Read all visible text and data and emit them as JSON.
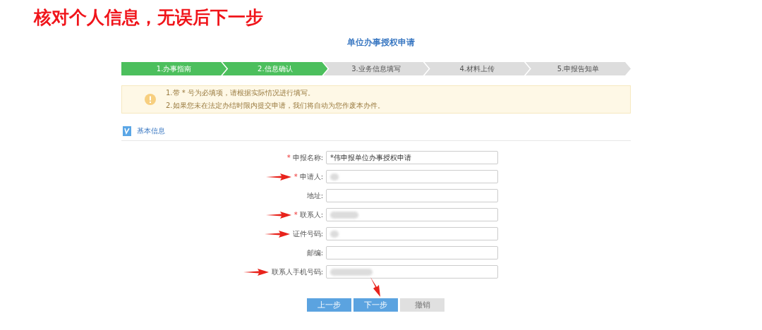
{
  "annotation": {
    "heading": "核对个人信息，无误后下一步"
  },
  "page_title": "单位办事授权申请",
  "steps": [
    {
      "label": "1.办事指南",
      "active": true
    },
    {
      "label": "2.信息确认",
      "active": true
    },
    {
      "label": "3.业务信息填写",
      "active": false
    },
    {
      "label": "4.材料上传",
      "active": false
    },
    {
      "label": "5.申报告知单",
      "active": false
    }
  ],
  "notice": [
    "1.带 * 号为必填项，请根据实际情况进行填写。",
    "2.如果您未在法定办结时限内提交申请，我们将自动为您作废本办件。"
  ],
  "section": {
    "title": "基本信息"
  },
  "fields": [
    {
      "label": "申报名称:",
      "required_mark": "*",
      "value": "*伟申报单位办事授权申请",
      "redacted": false,
      "arrow": false
    },
    {
      "label": "申请人:",
      "required_mark": "*",
      "redacted": true,
      "arrow": true
    },
    {
      "label": "地址:",
      "redacted": false,
      "arrow": false
    },
    {
      "label": "联系人:",
      "required_mark": "*",
      "redacted": true,
      "arrow": true
    },
    {
      "label": "证件号码:",
      "redacted": true,
      "arrow": true
    },
    {
      "label": "邮编:",
      "redacted": false,
      "arrow": false
    },
    {
      "label": "联系人手机号码:",
      "redacted": true,
      "arrow": true
    }
  ],
  "buttons": [
    {
      "label": "上一步",
      "disabled": false,
      "arrow": false
    },
    {
      "label": "下一步",
      "disabled": false,
      "arrow": true
    },
    {
      "label": "撤销",
      "disabled": true,
      "arrow": false
    }
  ]
}
